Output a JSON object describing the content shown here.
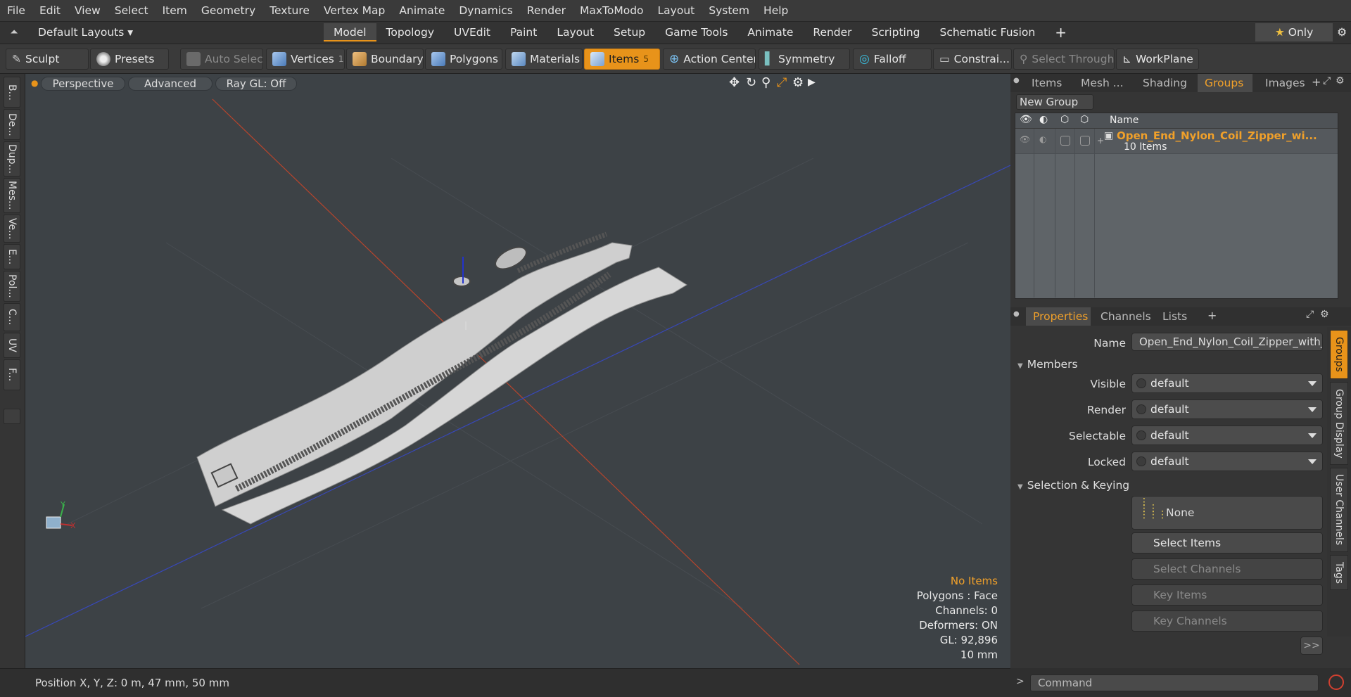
{
  "menu": [
    "File",
    "Edit",
    "View",
    "Select",
    "Item",
    "Geometry",
    "Texture",
    "Vertex Map",
    "Animate",
    "Dynamics",
    "Render",
    "MaxToModo",
    "Layout",
    "System",
    "Help"
  ],
  "layout_bar": {
    "preset": "Default Layouts",
    "tabs": [
      "Model",
      "Topology",
      "UVEdit",
      "Paint",
      "Layout",
      "Setup",
      "Game Tools",
      "Animate",
      "Render",
      "Scripting",
      "Schematic Fusion"
    ],
    "active_tab": "Model",
    "only_label": "Only"
  },
  "toolbar": {
    "sculpt": "Sculpt",
    "presets": "Presets",
    "auto_select": "Auto Select",
    "vertices": "Vertices",
    "vertices_count": "1",
    "boundary": "Boundary",
    "polygons": "Polygons",
    "materials": "Materials",
    "items": "Items",
    "items_count": "5",
    "action_center": "Action Center",
    "symmetry": "Symmetry",
    "falloff": "Falloff",
    "constraints": "Constrai...",
    "select_through": "Select Through",
    "workplane": "WorkPlane"
  },
  "left_tabs": [
    "B...",
    "De...",
    "Dup...",
    "Mes...",
    "Ve...",
    "E...",
    "Pol...",
    "C...",
    "UV",
    "F..."
  ],
  "viewport": {
    "perspective": "Perspective",
    "advanced": "Advanced",
    "raygl": "Ray GL: Off",
    "hud": {
      "items": "No Items",
      "polygons": "Polygons : Face",
      "channels": "Channels: 0",
      "deformers": "Deformers: ON",
      "gl": "GL: 92,896",
      "unit": "10 mm"
    },
    "axis": {
      "y": "Y",
      "x": "X"
    }
  },
  "status": {
    "position": "Position X, Y, Z:  0 m, 47 mm, 50 mm",
    "command_placeholder": "Command"
  },
  "groups_panel": {
    "tabs": [
      "Items",
      "Mesh ...",
      "Shading",
      "Groups",
      "Images"
    ],
    "active_tab": "Groups",
    "new_group": "New Group",
    "name_header": "Name",
    "group_name": "Open_End_Nylon_Coil_Zipper_wi...",
    "group_count": "10 Items"
  },
  "properties_panel": {
    "tabs": [
      "Properties",
      "Channels",
      "Lists"
    ],
    "active_tab": "Properties",
    "name_label": "Name",
    "name_value": "Open_End_Nylon_Coil_Zipper_with_Sl",
    "members_section": "Members",
    "visible_label": "Visible",
    "visible_value": "default",
    "render_label": "Render",
    "render_value": "default",
    "selectable_label": "Selectable",
    "selectable_value": "default",
    "locked_label": "Locked",
    "locked_value": "default",
    "keying_section": "Selection & Keying",
    "none_label": "None",
    "select_items": "Select Items",
    "select_channels": "Select Channels",
    "key_items": "Key Items",
    "key_channels": "Key Channels",
    "more": ">>"
  },
  "side_tabs": [
    "Groups",
    "Group Display",
    "User Channels",
    "Tags"
  ],
  "colors": {
    "accent": "#e8931a",
    "viewport_bg": "#3d4246",
    "panel_bg": "#353535"
  }
}
